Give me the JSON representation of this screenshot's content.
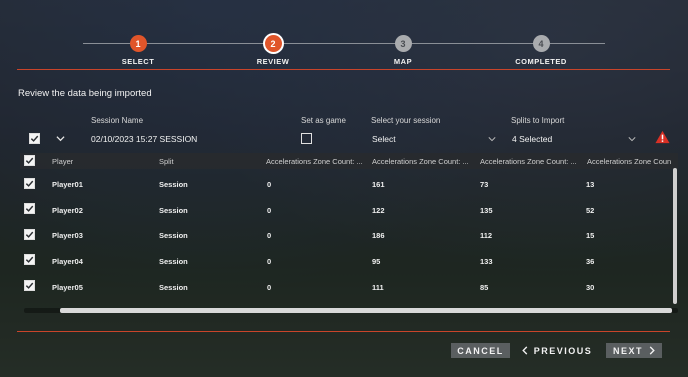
{
  "steps": [
    {
      "number": "1",
      "label": "SELECT",
      "state": "done"
    },
    {
      "number": "2",
      "label": "REVIEW",
      "state": "current"
    },
    {
      "number": "3",
      "label": "MAP",
      "state": "pending"
    },
    {
      "number": "4",
      "label": "COMPLETED",
      "state": "pending"
    }
  ],
  "review_title": "Review the data being imported",
  "session": {
    "name_label": "Session Name",
    "name_value": "02/10/2023 15:27 SESSION",
    "game_label": "Set as game",
    "select_label": "Select your session",
    "select_value": "Select",
    "splits_label": "Splits to Import",
    "splits_value": "4 Selected"
  },
  "table": {
    "headers": [
      "Player",
      "Split",
      "Accelerations Zone Count: ...",
      "Accelerations Zone Count: ...",
      "Accelerations Zone Count: ...",
      "Accelerations Zone Coun"
    ],
    "rows": [
      {
        "player": "Player01",
        "split": "Session",
        "c1": "0",
        "c2": "161",
        "c3": "73",
        "c4": "13"
      },
      {
        "player": "Player02",
        "split": "Session",
        "c1": "0",
        "c2": "122",
        "c3": "135",
        "c4": "52"
      },
      {
        "player": "Player03",
        "split": "Session",
        "c1": "0",
        "c2": "186",
        "c3": "112",
        "c4": "15"
      },
      {
        "player": "Player04",
        "split": "Session",
        "c1": "0",
        "c2": "95",
        "c3": "133",
        "c4": "36"
      },
      {
        "player": "Player05",
        "split": "Session",
        "c1": "0",
        "c2": "111",
        "c3": "85",
        "c4": "30"
      }
    ]
  },
  "buttons": {
    "cancel": "CANCEL",
    "previous": "PREVIOUS",
    "next": "NEXT"
  },
  "colors": {
    "accent": "#e0552a",
    "warning": "#d93025"
  }
}
